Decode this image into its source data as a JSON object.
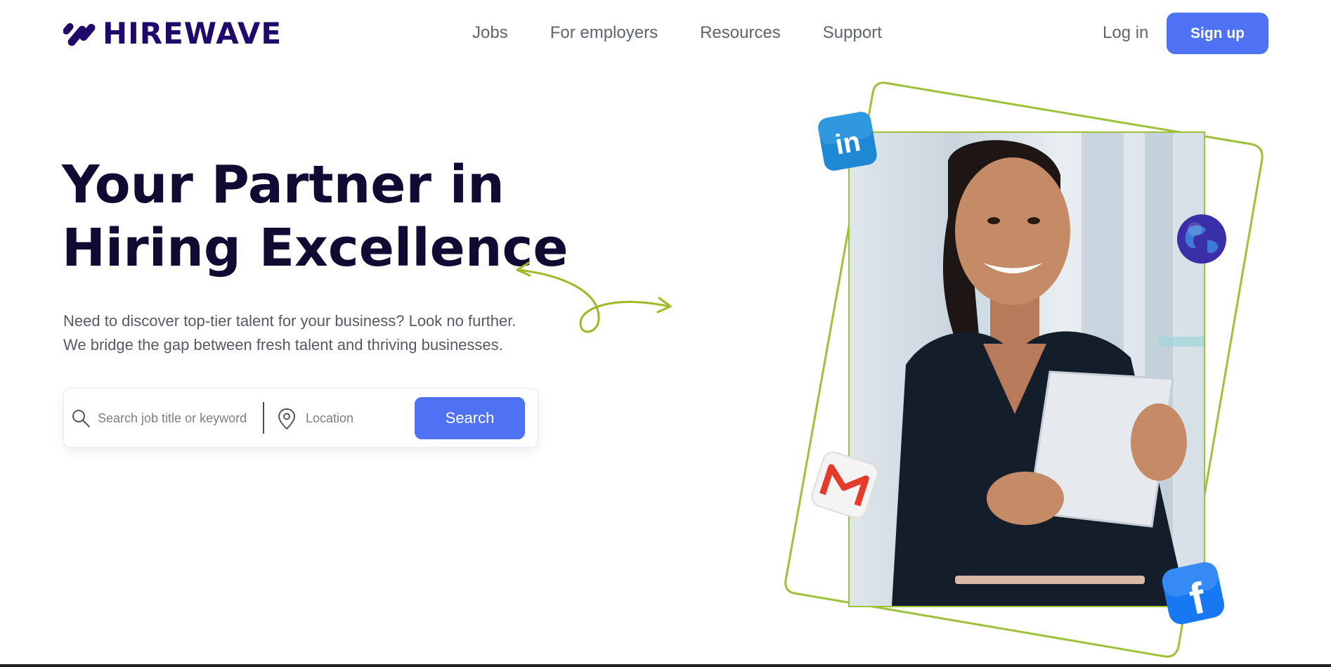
{
  "brand": {
    "name": "HIREWAVE",
    "logo_icon": "wave-slashes-logo",
    "color": "#1f0a6b"
  },
  "nav": {
    "links": [
      "Jobs",
      "For employers",
      "Resources",
      "Support"
    ],
    "login": "Log in",
    "signup": "Sign up"
  },
  "hero": {
    "title_lines": [
      "Your Partner in",
      "Hiring Excellence"
    ],
    "subtitle_lines": [
      "Need to discover top-tier talent for your business? Look no further.",
      "We bridge the gap between fresh talent and thriving businesses."
    ]
  },
  "search": {
    "keyword_placeholder": "Search job title or keyword",
    "location_placeholder": "Location",
    "button": "Search"
  },
  "image": {
    "subject": "smiling woman holding tablet",
    "badges": [
      "linkedin-icon",
      "globe-icon",
      "gmail-icon",
      "facebook-icon"
    ]
  },
  "colors": {
    "accent": "#4f72f5",
    "frame": "#9fc13a",
    "title": "#120a33"
  }
}
